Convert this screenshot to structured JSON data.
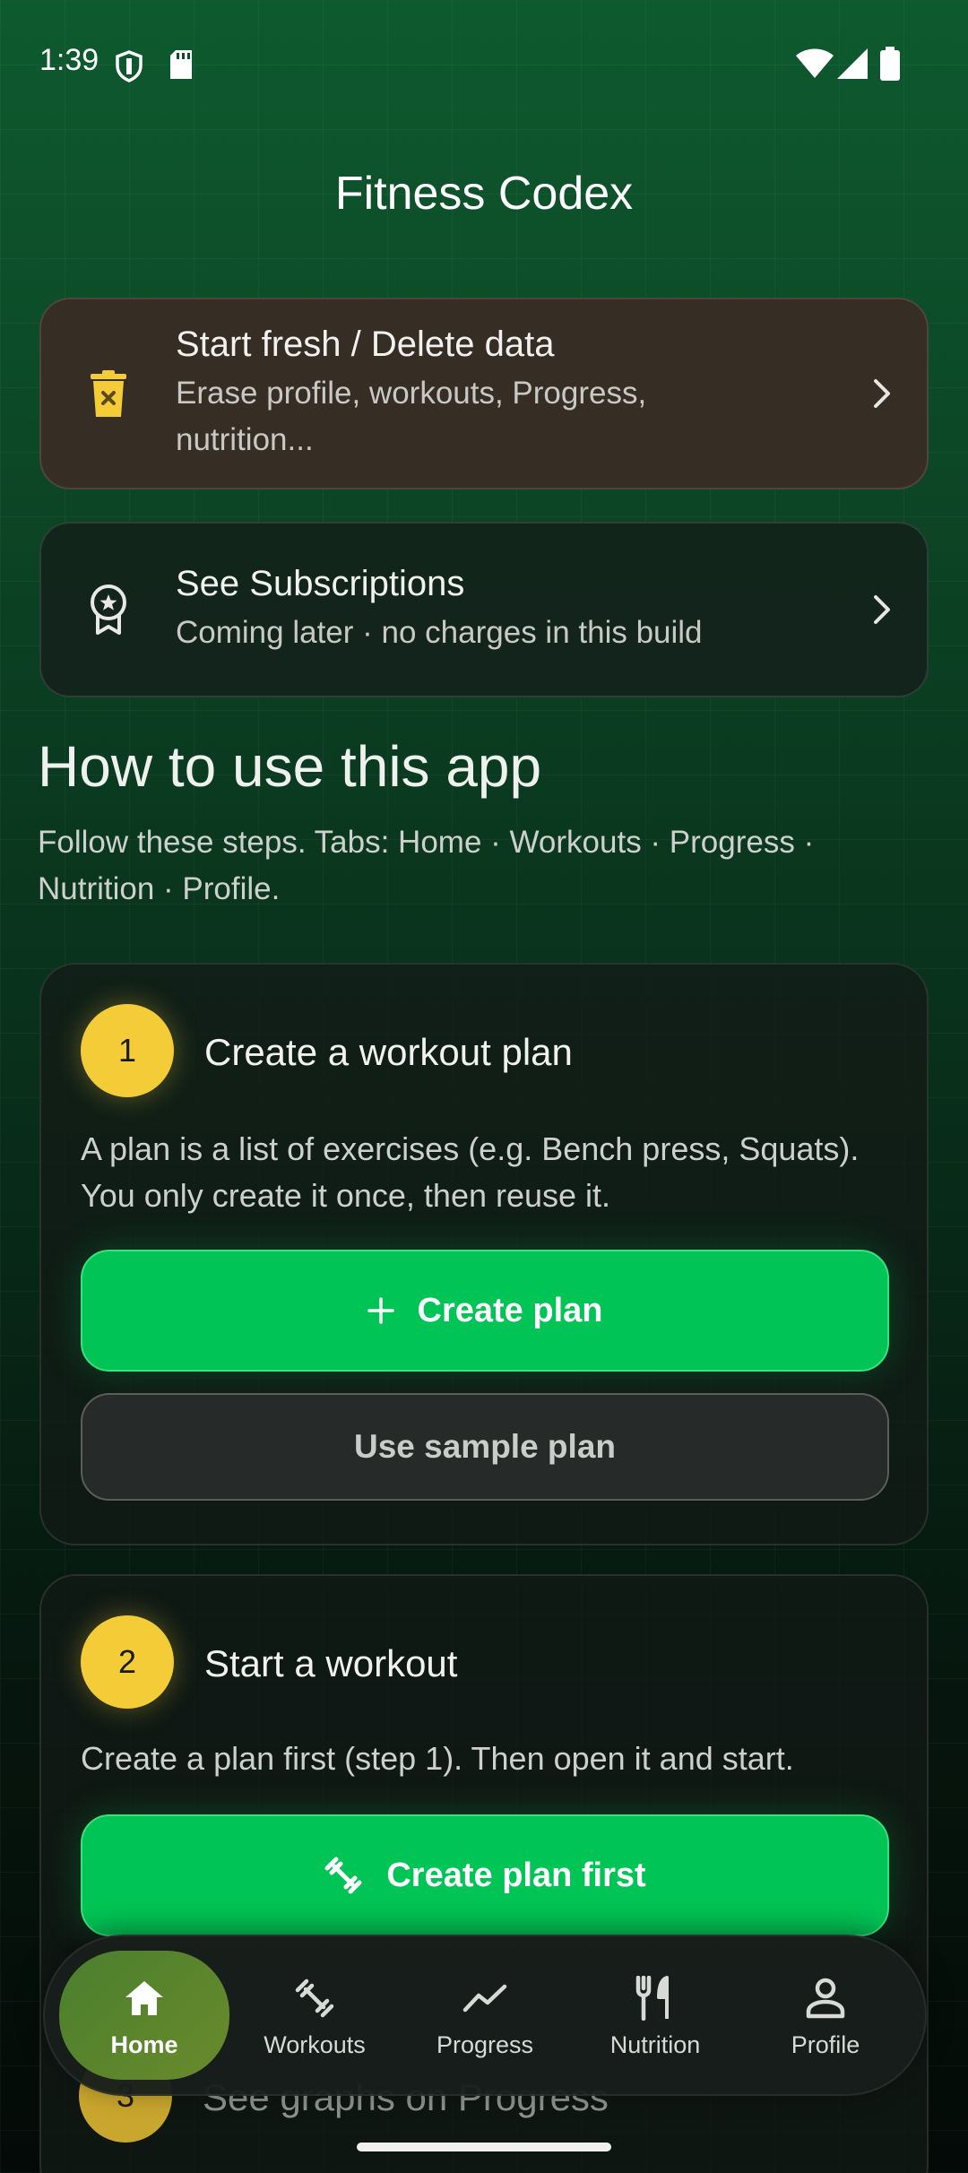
{
  "status_bar": {
    "time": "1:39",
    "icons": [
      "shield-icon",
      "sd-card-icon",
      "wifi-icon",
      "signal-icon",
      "battery-icon"
    ]
  },
  "header": {
    "title": "Fitness Codex"
  },
  "cards": {
    "delete": {
      "title": "Start fresh / Delete data",
      "subtitle_line1": "Erase profile, workouts, Progress,",
      "subtitle_line2": "nutrition...",
      "icon": "trash-icon"
    },
    "subscriptions": {
      "title": "See Subscriptions",
      "subtitle": "Coming later · no charges in this build",
      "icon": "award-icon"
    }
  },
  "how_to": {
    "title": "How to use this app",
    "description": "Follow these steps. Tabs: Home · Workouts · Progress · Nutrition · Profile."
  },
  "steps": [
    {
      "number": "1",
      "title": "Create a workout plan",
      "description": "A plan is a list of exercises (e.g. Bench press, Squats). You only create it once, then reuse it.",
      "primary_label": "Create plan",
      "secondary_label": "Use sample plan"
    },
    {
      "number": "2",
      "title": "Start a workout",
      "description": "Create a plan first (step 1). Then open it and start.",
      "primary_label": "Create plan first"
    },
    {
      "number": "3",
      "title": "See graphs on Progress"
    }
  ],
  "nav": {
    "items": [
      {
        "label": "Home",
        "icon": "home-icon",
        "active": true
      },
      {
        "label": "Workouts",
        "icon": "dumbbell-icon",
        "active": false
      },
      {
        "label": "Progress",
        "icon": "trend-icon",
        "active": false
      },
      {
        "label": "Nutrition",
        "icon": "fork-knife-icon",
        "active": false
      },
      {
        "label": "Profile",
        "icon": "person-icon",
        "active": false
      }
    ]
  },
  "colors": {
    "accent_green": "#00c455",
    "badge_yellow": "#f4cc38",
    "delete_card": "#362d24"
  }
}
